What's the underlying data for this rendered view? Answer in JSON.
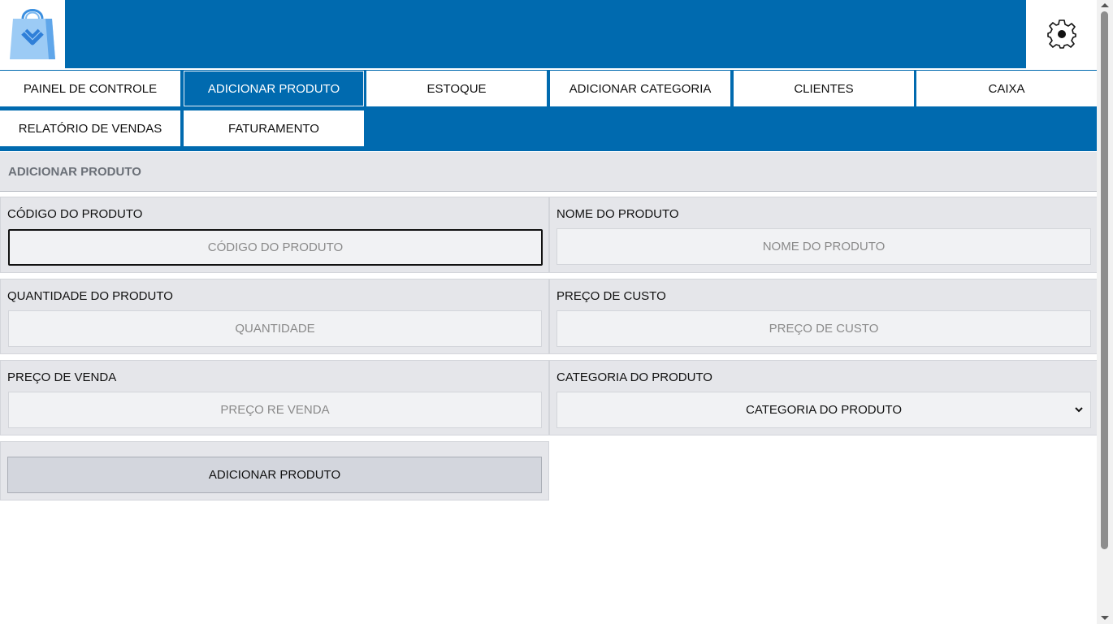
{
  "header": {
    "logo_icon": "shopping-bag-logo-icon",
    "settings_icon": "gear-icon",
    "brand_color": "#006aaf"
  },
  "nav": {
    "tabs": [
      {
        "label": "PAINEL DE CONTROLE",
        "active": false
      },
      {
        "label": "ADICIONAR PRODUTO",
        "active": true
      },
      {
        "label": "ESTOQUE",
        "active": false
      },
      {
        "label": "ADICIONAR CATEGORIA",
        "active": false
      },
      {
        "label": "CLIENTES",
        "active": false
      },
      {
        "label": "CAIXA",
        "active": false
      },
      {
        "label": "RELATÓRIO DE VENDAS",
        "active": false
      },
      {
        "label": "FATURAMENTO",
        "active": false
      }
    ]
  },
  "page": {
    "title": "ADICIONAR PRODUTO"
  },
  "form": {
    "codigo": {
      "label": "CÓDIGO DO PRODUTO",
      "placeholder": "CÓDIGO DO PRODUTO",
      "value": ""
    },
    "nome": {
      "label": "NOME DO PRODUTO",
      "placeholder": "NOME DO PRODUTO",
      "value": ""
    },
    "quantidade": {
      "label": "QUANTIDADE DO PRODUTO",
      "placeholder": "QUANTIDADE",
      "value": ""
    },
    "custo": {
      "label": "PREÇO DE CUSTO",
      "placeholder": "PREÇO DE CUSTO",
      "value": ""
    },
    "venda": {
      "label": "PREÇO DE VENDA",
      "placeholder": "PREÇO RE VENDA",
      "value": ""
    },
    "categoria": {
      "label": "CATEGORIA DO PRODUTO",
      "selected": "CATEGORIA DO PRODUTO"
    },
    "submit_label": "ADICIONAR PRODUTO"
  }
}
